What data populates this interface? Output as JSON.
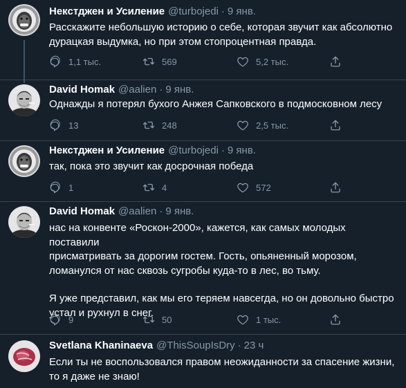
{
  "tweets": [
    {
      "author": "Некстджен и Усиление",
      "handle": "@turbojedi",
      "date": "9 янв.",
      "text": "Расскажите небольшую историю о себе, которая звучит как абсолютно\nдурацкая выдумка, но при этом стопроцентная правда.",
      "replies": "1,1 тыс.",
      "retweets": "569",
      "likes": "5,2 тыс.",
      "avatar": "astronaut-portrait"
    },
    {
      "author": "David Homak",
      "handle": "@aalien",
      "date": "9 янв.",
      "text": "Однажды я потерял бухого Анжея Сапковского в подмосковном лесу",
      "replies": "13",
      "retweets": "248",
      "likes": "2,5 тыс.",
      "avatar": "man-portrait"
    },
    {
      "author": "Некстджен и Усиление",
      "handle": "@turbojedi",
      "date": "9 янв.",
      "text": "так, пока это звучит как досрочная победа",
      "replies": "1",
      "retweets": "4",
      "likes": "572",
      "avatar": "astronaut-portrait"
    },
    {
      "author": "David Homak",
      "handle": "@aalien",
      "date": "9 янв.",
      "text": "нас на конвенте «Роскон-2000», кажется, как самых молодых поставили\nприсматривать за дорогим гостем. Гость, опьяненный морозом,\nломанулся от нас сквозь сугробы куда-то в лес, во тьму.",
      "text2": "Я уже представил, как мы его теряем навсегда, но он довольно быстро\nустал и рухнул в снег.",
      "replies": "9",
      "retweets": "50",
      "likes": "1 тыс.",
      "avatar": "man-portrait"
    },
    {
      "author": "Svetlana Khaninaeva",
      "handle": "@ThisSoupIsDry",
      "date": "23 ч",
      "text": "Если ты не воспользовался правом неожиданности за спасение жизни,\nто я даже не знаю!",
      "avatar": "meat-portrait"
    }
  ],
  "icons": {
    "reply": "reply-icon",
    "retweet": "retweet-icon",
    "like": "heart-icon",
    "share": "share-icon"
  },
  "colors": {
    "background": "#15202b",
    "text": "#ffffff",
    "secondary": "#8899a6",
    "divider": "#38444d"
  }
}
